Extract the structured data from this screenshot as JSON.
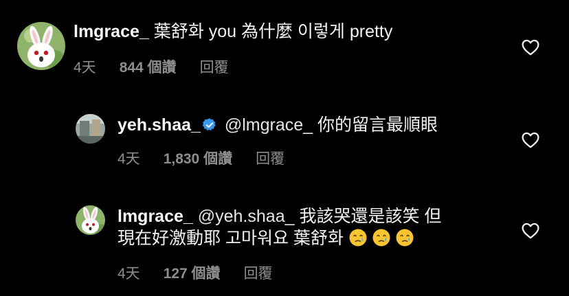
{
  "comments": [
    {
      "username": "lmgrace_",
      "text": "葉舒화 you 為什麼 이렇게 pretty",
      "time": "4天",
      "likes": "844 個讚",
      "reply_label": "回覆",
      "icons": {
        "like": "heart-outline-icon",
        "avatar": "bunny-avatar"
      }
    },
    {
      "username": "yeh.shaa_",
      "verified": true,
      "mention": "@lmgrace_",
      "text": "你的留言最順眼",
      "time": "4天",
      "likes": "1,830 個讚",
      "reply_label": "回覆",
      "icons": {
        "like": "heart-outline-icon",
        "avatar": "photo-avatar",
        "verified": "verified-badge-icon"
      }
    },
    {
      "username": "lmgrace_",
      "mention": "@yeh.shaa_",
      "text_line1": "我該哭還是該笑 但",
      "text_line2": "現在好激動耶 고마워요 葉舒화",
      "time": "4天",
      "likes": "127 個讚",
      "reply_label": "回覆",
      "icons": {
        "like": "heart-outline-icon",
        "avatar": "bunny-avatar",
        "emoji": "face-holding-back-tears-emoji"
      }
    }
  ],
  "colors": {
    "background": "#000000",
    "text": "#f5f5f5",
    "meta": "#8e8e8e",
    "verified": "#3897f0",
    "emoji": "#f7c531"
  }
}
